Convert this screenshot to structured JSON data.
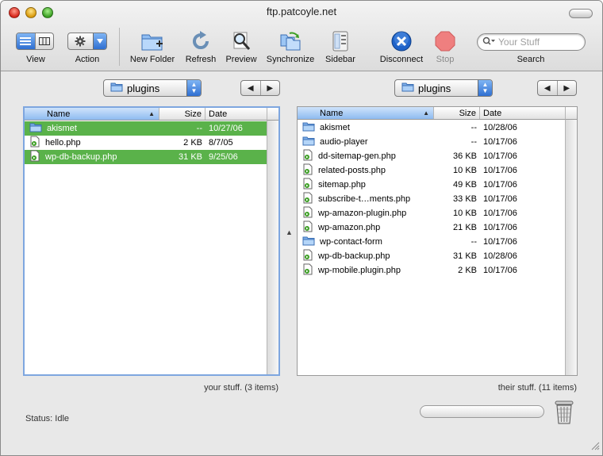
{
  "window": {
    "title": "ftp.patcoyle.net"
  },
  "toolbar": {
    "view_label": "View",
    "action_label": "Action",
    "new_folder_label": "New Folder",
    "refresh_label": "Refresh",
    "preview_label": "Preview",
    "synchronize_label": "Synchronize",
    "sidebar_label": "Sidebar",
    "disconnect_label": "Disconnect",
    "stop_label": "Stop",
    "search_label": "Search",
    "search_placeholder": "Your Stuff"
  },
  "left_pane": {
    "folder": "plugins",
    "columns": {
      "name": "Name",
      "size": "Size",
      "date": "Date"
    },
    "files": [
      {
        "name": "akismet",
        "size": "--",
        "date": "10/27/06",
        "type": "folder",
        "selected": true
      },
      {
        "name": "hello.php",
        "size": "2 KB",
        "date": "8/7/05",
        "type": "php",
        "selected": false
      },
      {
        "name": "wp-db-backup.php",
        "size": "31 KB",
        "date": "9/25/06",
        "type": "php",
        "selected": true
      }
    ],
    "caption": "your stuff. (3 items)"
  },
  "right_pane": {
    "folder": "plugins",
    "columns": {
      "name": "Name",
      "size": "Size",
      "date": "Date"
    },
    "files": [
      {
        "name": "akismet",
        "size": "--",
        "date": "10/28/06",
        "type": "folder"
      },
      {
        "name": "audio-player",
        "size": "--",
        "date": "10/17/06",
        "type": "folder"
      },
      {
        "name": "dd-sitemap-gen.php",
        "size": "36 KB",
        "date": "10/17/06",
        "type": "php"
      },
      {
        "name": "related-posts.php",
        "size": "10 KB",
        "date": "10/17/06",
        "type": "php"
      },
      {
        "name": "sitemap.php",
        "size": "49 KB",
        "date": "10/17/06",
        "type": "php"
      },
      {
        "name": "subscribe-t…ments.php",
        "size": "33 KB",
        "date": "10/17/06",
        "type": "php"
      },
      {
        "name": "wp-amazon-plugin.php",
        "size": "10 KB",
        "date": "10/17/06",
        "type": "php"
      },
      {
        "name": "wp-amazon.php",
        "size": "21 KB",
        "date": "10/17/06",
        "type": "php"
      },
      {
        "name": "wp-contact-form",
        "size": "--",
        "date": "10/17/06",
        "type": "folder"
      },
      {
        "name": "wp-db-backup.php",
        "size": "31 KB",
        "date": "10/28/06",
        "type": "php"
      },
      {
        "name": "wp-mobile.plugin.php",
        "size": "2 KB",
        "date": "10/17/06",
        "type": "php"
      }
    ],
    "caption": "their stuff. (11 items)"
  },
  "status": {
    "text": "Status: Idle"
  },
  "colors": {
    "selection": "#5ab24a",
    "accent": "#2f6fd1",
    "disconnect": "#1f63c9",
    "stop": "#e04848"
  }
}
